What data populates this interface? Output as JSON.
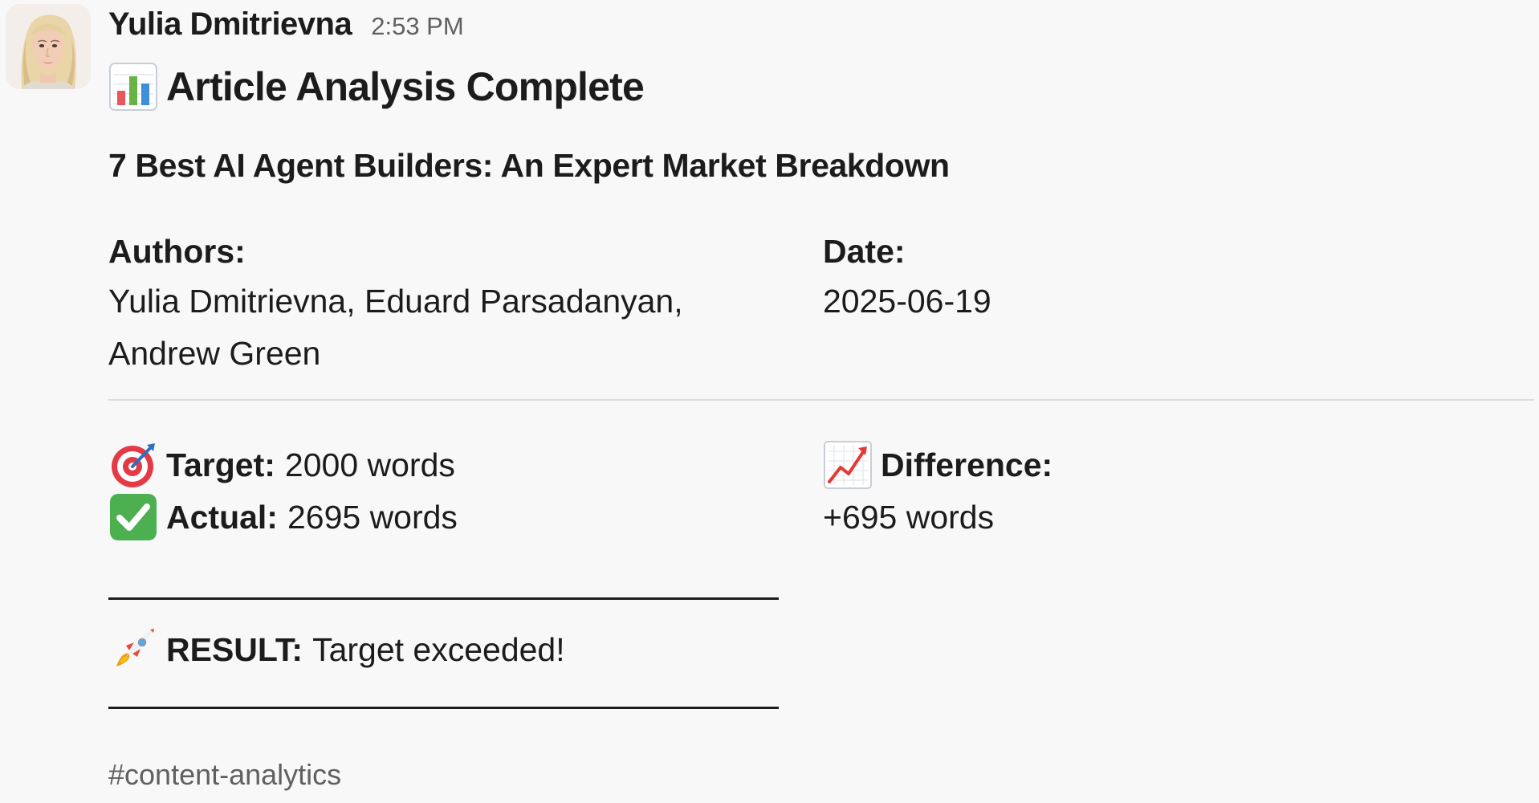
{
  "message": {
    "sender": "Yulia Dmitrievna",
    "timestamp": "2:53 PM",
    "avatar": "avatar-photo",
    "title_icon": "bar-chart-emoji",
    "title": "Article Analysis Complete",
    "article_title": "7 Best AI Agent Builders: An Expert Market Breakdown",
    "authors_label": "Authors:",
    "authors_value": "Yulia Dmitrievna, Eduard Parsadanyan, Andrew Green",
    "date_label": "Date:",
    "date_value": "2025-06-19",
    "target_icon": "target-emoji",
    "target_label": "Target:",
    "target_value": "2000 words",
    "actual_icon": "check-mark-emoji",
    "actual_label": "Actual:",
    "actual_value": "2695 words",
    "difference_icon": "chart-increasing-emoji",
    "difference_label": "Difference:",
    "difference_value": "+695 words",
    "result_icon": "rocket-emoji",
    "result_label": "RESULT:",
    "result_value": "Target exceeded!",
    "channel_tag": "#content-analytics"
  },
  "colors": {
    "background": "#f8f8f8",
    "text": "#1d1c1d",
    "muted": "#616061",
    "divider": "#dcdcdc"
  }
}
